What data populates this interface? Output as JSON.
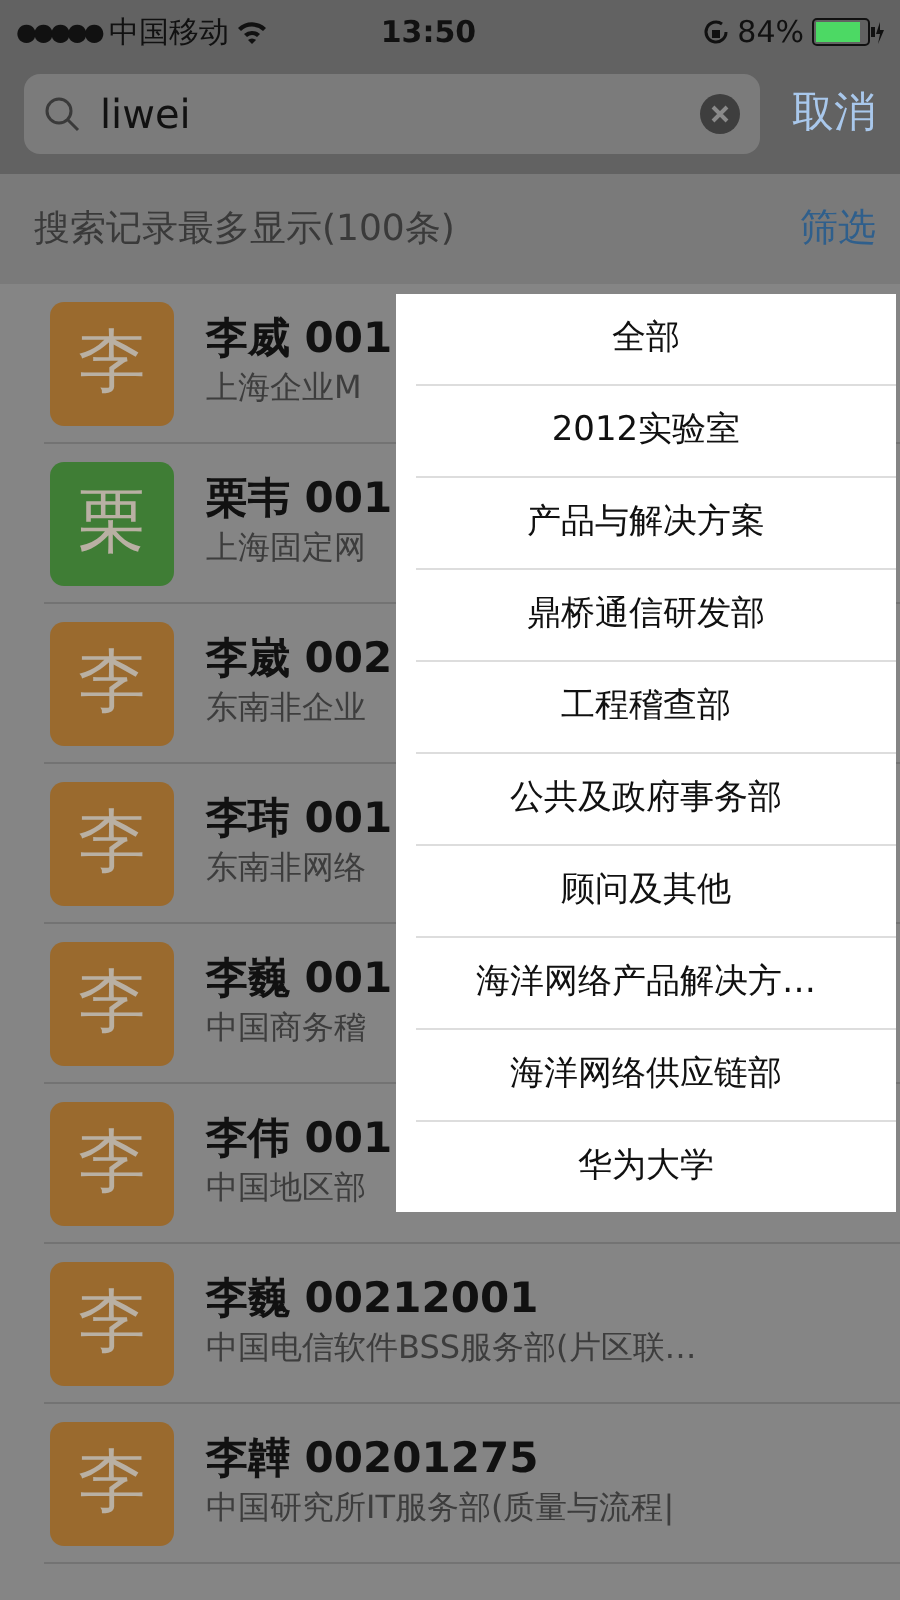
{
  "status_bar": {
    "signal": "●●●●●",
    "carrier": "中国移动",
    "time": "13:50",
    "battery": "84%"
  },
  "search": {
    "value": "liwei",
    "cancel": "取消"
  },
  "header": {
    "note": "搜索记录最多显示(100条)",
    "filter": "筛选"
  },
  "contacts": [
    {
      "avatar": "李",
      "color": "#9a6a2e",
      "name": "李威 001",
      "dept": "上海企业M"
    },
    {
      "avatar": "栗",
      "color": "#3f7d35",
      "name": "栗韦 001",
      "dept": "上海固定网"
    },
    {
      "avatar": "李",
      "color": "#9a6a2e",
      "name": "李崴 002",
      "dept": "东南非企业"
    },
    {
      "avatar": "李",
      "color": "#9a6a2e",
      "name": "李玮 001",
      "dept": "东南非网络"
    },
    {
      "avatar": "李",
      "color": "#9a6a2e",
      "name": "李巍 001",
      "dept": "中国商务稽"
    },
    {
      "avatar": "李",
      "color": "#9a6a2e",
      "name": "李伟 001",
      "dept": "中国地区部"
    },
    {
      "avatar": "李",
      "color": "#9a6a2e",
      "name": "李巍 00212001",
      "dept": "中国电信软件BSS服务部(片区联…"
    },
    {
      "avatar": "李",
      "color": "#9a6a2e",
      "name": "李韡 00201275",
      "dept": "中国研究所IT服务部(质量与流程|"
    }
  ],
  "filter_menu": [
    "全部",
    "2012实验室",
    "产品与解决方案",
    "鼎桥通信研发部",
    "工程稽查部",
    "公共及政府事务部",
    "顾问及其他",
    "海洋网络产品解决方…",
    "海洋网络供应链部",
    "华为大学"
  ]
}
